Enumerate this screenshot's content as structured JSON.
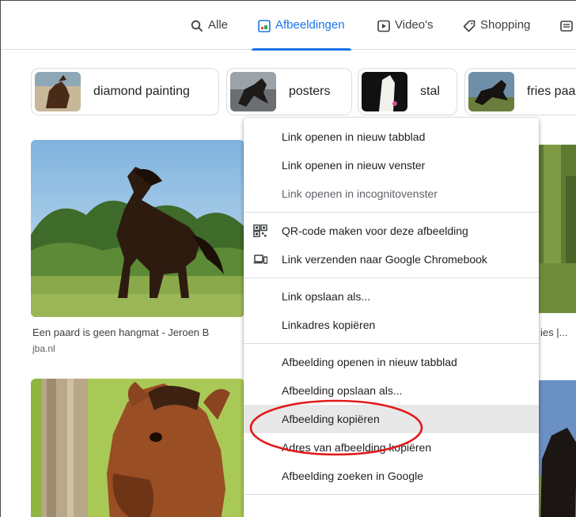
{
  "tabs": [
    {
      "label": "Alle",
      "icon": "search-icon"
    },
    {
      "label": "Afbeeldingen",
      "icon": "image-icon",
      "active": true
    },
    {
      "label": "Video's",
      "icon": "play-icon"
    },
    {
      "label": "Shopping",
      "icon": "tag-icon"
    }
  ],
  "chips": [
    {
      "label": "diamond painting"
    },
    {
      "label": "posters"
    },
    {
      "label": "stal"
    },
    {
      "label": "fries paa"
    }
  ],
  "results": [
    {
      "caption": "Een paard is geen hangmat - Jeroen B",
      "domain": "jba.nl"
    },
    {
      "caption": "ies |..."
    }
  ],
  "context_menu": {
    "groups": [
      [
        {
          "label": "Link openen in nieuw tabblad"
        },
        {
          "label": "Link openen in nieuw venster"
        },
        {
          "label": "Link openen in incognitovenster",
          "dim": true
        }
      ],
      [
        {
          "label": "QR-code maken voor deze afbeelding",
          "icon": "qr-code-icon"
        },
        {
          "label": "Link verzenden naar Google Chromebook",
          "icon": "devices-icon"
        }
      ],
      [
        {
          "label": "Link opslaan als..."
        },
        {
          "label": "Linkadres kopiëren"
        }
      ],
      [
        {
          "label": "Afbeelding openen in nieuw tabblad"
        },
        {
          "label": "Afbeelding opslaan als..."
        },
        {
          "label": "Afbeelding kopiëren",
          "highlighted": true
        },
        {
          "label": "Adres van afbeelding kopiëren"
        },
        {
          "label": "Afbeelding zoeken in Google"
        }
      ]
    ]
  },
  "colors": {
    "accent": "#1a73e8",
    "annotation": "#e01a1a",
    "highlight": "#e8e8e8"
  }
}
